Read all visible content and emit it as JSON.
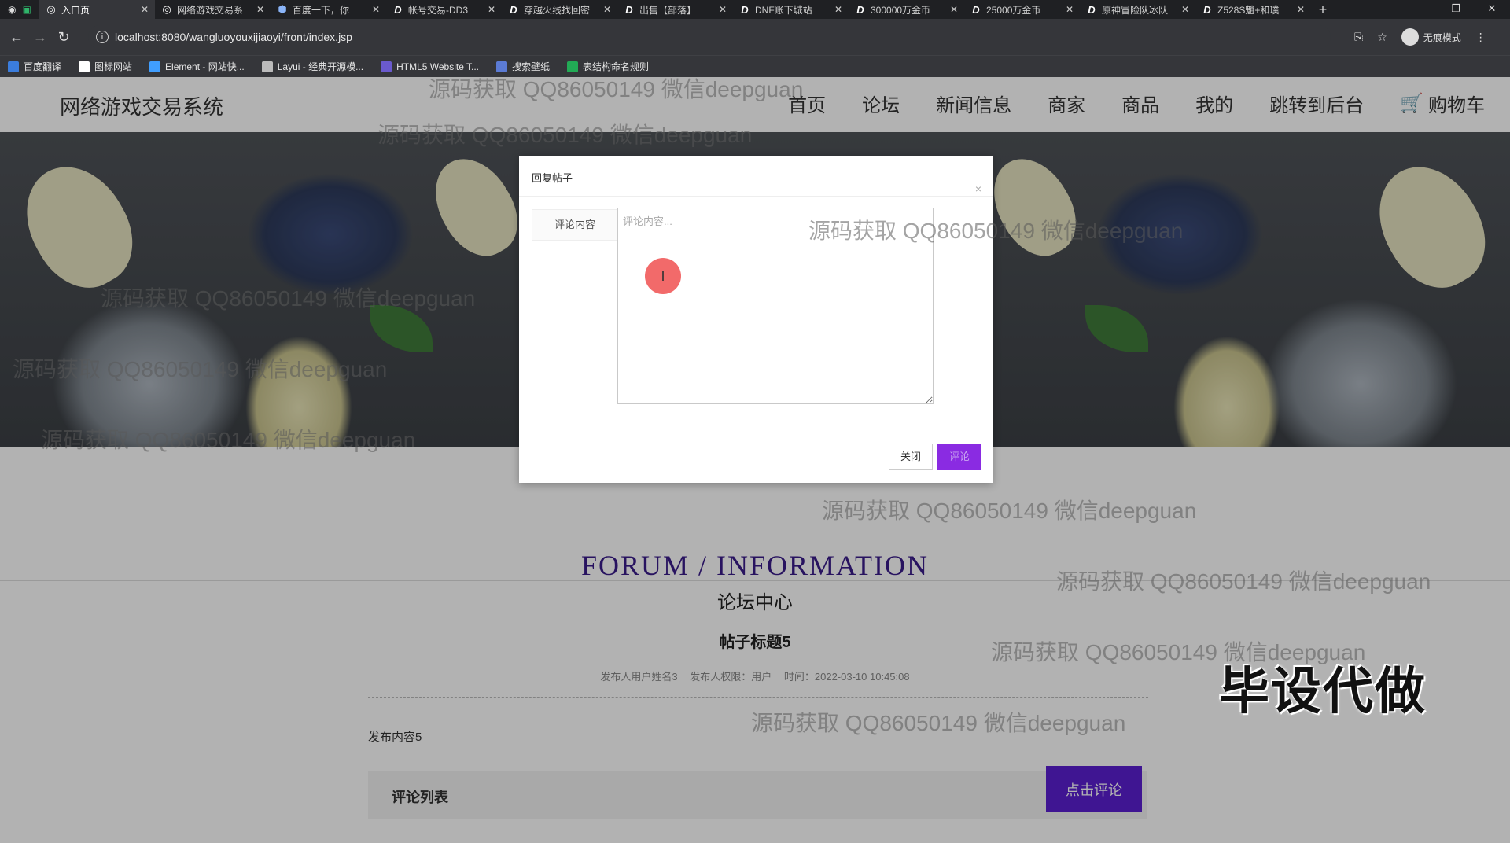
{
  "browser": {
    "tabs": [
      {
        "title": "入口页",
        "icon": "globe-icon",
        "active": true
      },
      {
        "title": "网络游戏交易系",
        "icon": "globe-icon"
      },
      {
        "title": "百度一下，你",
        "icon": "baidu-icon"
      },
      {
        "title": "帐号交易-DD3",
        "icon": "d-icon"
      },
      {
        "title": "穿越火线找回密",
        "icon": "d-icon"
      },
      {
        "title": "出售【部落】",
        "icon": "d-icon"
      },
      {
        "title": "DNF账下城站",
        "icon": "d-icon"
      },
      {
        "title": "300000万金币",
        "icon": "d-icon"
      },
      {
        "title": "25000万金币",
        "icon": "d-icon"
      },
      {
        "title": "原神冒险队冰队",
        "icon": "d-icon"
      },
      {
        "title": "Z528S魈+和璞",
        "icon": "d-icon"
      }
    ],
    "new_tab": "+",
    "url": "localhost:8080/wangluoyouxijiaoyi/front/index.jsp",
    "incognito_label": "无痕模式",
    "bookmarks": [
      {
        "label": "百度翻译",
        "color": "#3b7ddd"
      },
      {
        "label": "图标网站",
        "color": "#ffffff"
      },
      {
        "label": "Element - 网站快...",
        "color": "#409eff"
      },
      {
        "label": "Layui - 经典开源模...",
        "color": "#bbbbbb"
      },
      {
        "label": "HTML5 Website T...",
        "color": "#6a5acd"
      },
      {
        "label": "搜索壁纸",
        "color": "#5b7bd5"
      },
      {
        "label": "表结构命名规则",
        "color": "#22aa55"
      }
    ]
  },
  "site": {
    "title": "网络游戏交易系统",
    "nav": [
      "首页",
      "论坛",
      "新闻信息",
      "商家",
      "商品",
      "我的",
      "跳转到后台"
    ],
    "cart_label": "购物车"
  },
  "forum": {
    "heading_en": "FORUM / INFORMATION",
    "heading_cn": "论坛中心",
    "post_title": "帖子标题5",
    "meta_author": "发布人用户姓名3",
    "meta_role": "发布人权限：用户",
    "meta_time": "时间：2022-03-10 10:45:08",
    "post_body": "发布内容5",
    "comment_list_label": "评论列表",
    "comment_button": "点击评论"
  },
  "dialog": {
    "title": "回复帖子",
    "close_x": "×",
    "field_label": "评论内容",
    "textarea_placeholder": "评论内容...",
    "textarea_value": "",
    "close_button": "关闭",
    "submit_button": "评论"
  },
  "watermarks": {
    "text": "源码获取 QQ86050149 微信deepguan",
    "stamp": "毕设代做"
  },
  "colors": {
    "accent_purple": "#5b1fd1",
    "submit_purple": "#8a2be2"
  }
}
